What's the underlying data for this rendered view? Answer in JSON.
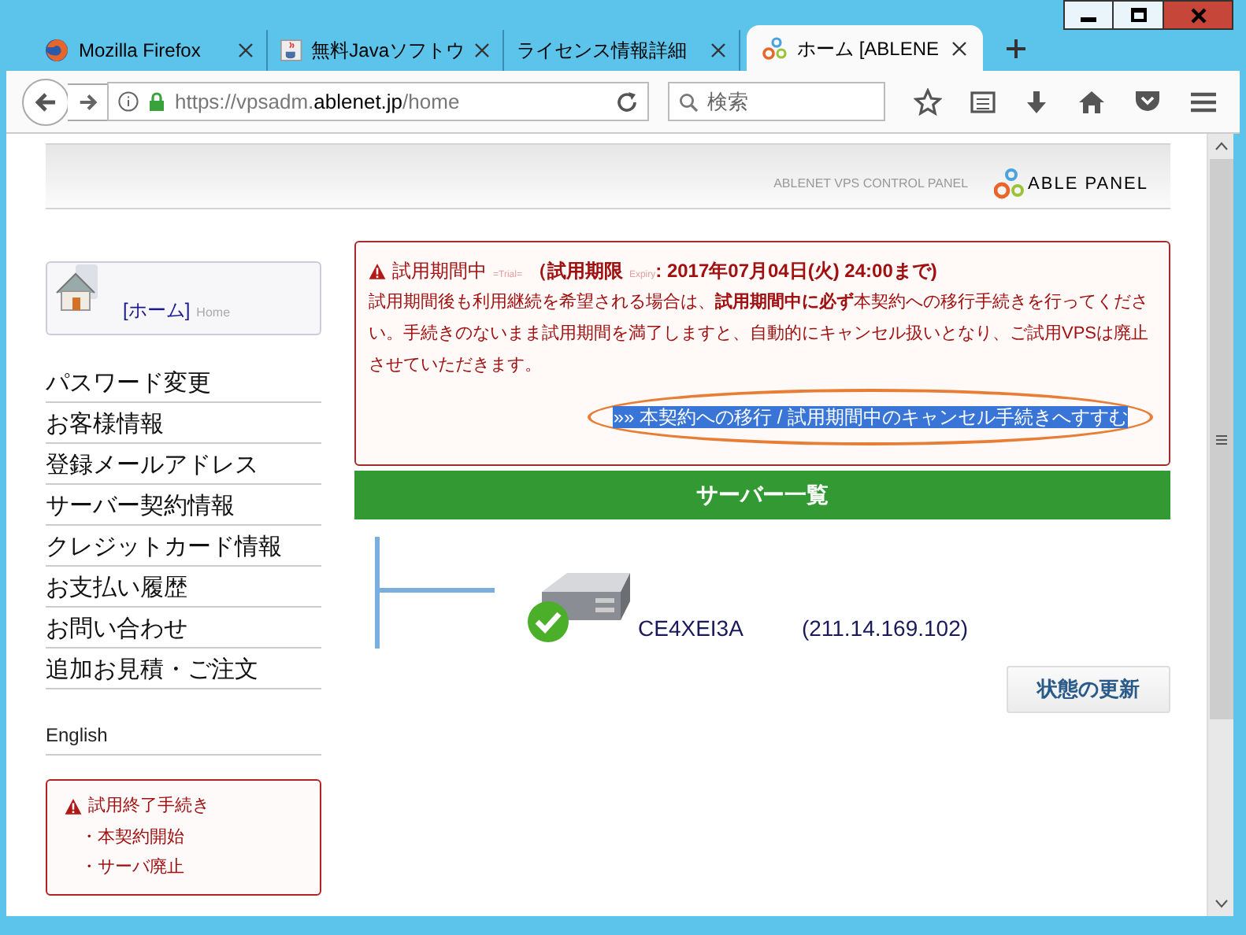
{
  "tabs": [
    {
      "title": "Mozilla Firefox",
      "kind": "firefox",
      "selected": false
    },
    {
      "title": "無料Javaソフトウ",
      "kind": "java",
      "selected": false
    },
    {
      "title": "ライセンス情報詳細",
      "kind": "plain",
      "selected": false
    },
    {
      "title": "ホーム [ABLENE",
      "kind": "able",
      "selected": true
    }
  ],
  "address_bar": {
    "url_prefix": "https://vpsadm.",
    "url_domain": "ablenet.jp",
    "url_path": "/home"
  },
  "search": {
    "placeholder": "検索"
  },
  "header": {
    "tagline": "ABLENET VPS CONTROL PANEL",
    "logo_text": "ABLE PANEL"
  },
  "sidebar": {
    "home": {
      "label": "[ホーム]",
      "sub": "Home"
    },
    "items": [
      {
        "label": "パスワード変更"
      },
      {
        "label": "お客様情報"
      },
      {
        "label": "登録メールアドレス"
      },
      {
        "label": "サーバー契約情報"
      },
      {
        "label": "クレジットカード情報"
      },
      {
        "label": "お支払い履歴"
      },
      {
        "label": "お問い合わせ"
      },
      {
        "label": "追加お見積・ご注文"
      }
    ],
    "language": "English",
    "trial_box": {
      "title": "試用終了手続き",
      "links": [
        "・本契約開始",
        "・サーバ廃止"
      ]
    }
  },
  "alert": {
    "title": "試用期間中",
    "trial_tag": "=Trial=",
    "deadline_label": "（試用期限",
    "expiry_tag": "Expiry",
    "deadline_value": ": 2017年07月04日(火) 24:00まで)",
    "body": "試用期間後も利用継続を希望される場合は、**試用期間中に必ず**本契約への移行手続きを行ってください。手続きのないまま試用期間を満了しますと、自動的にキャンセル扱いとなり、ご試用VPSは廃止させていただきます。",
    "link": {
      "label": "»» 本契約への移行 / 試用期間中のキャンセル手続きへすすむ",
      "selected": true
    }
  },
  "server_list": {
    "title": "サーバー一覧",
    "servers": [
      {
        "name": "CE4XEI3A",
        "ip": "(211.14.169.102)",
        "running": true
      }
    ],
    "refresh_button": "状態の更新"
  }
}
